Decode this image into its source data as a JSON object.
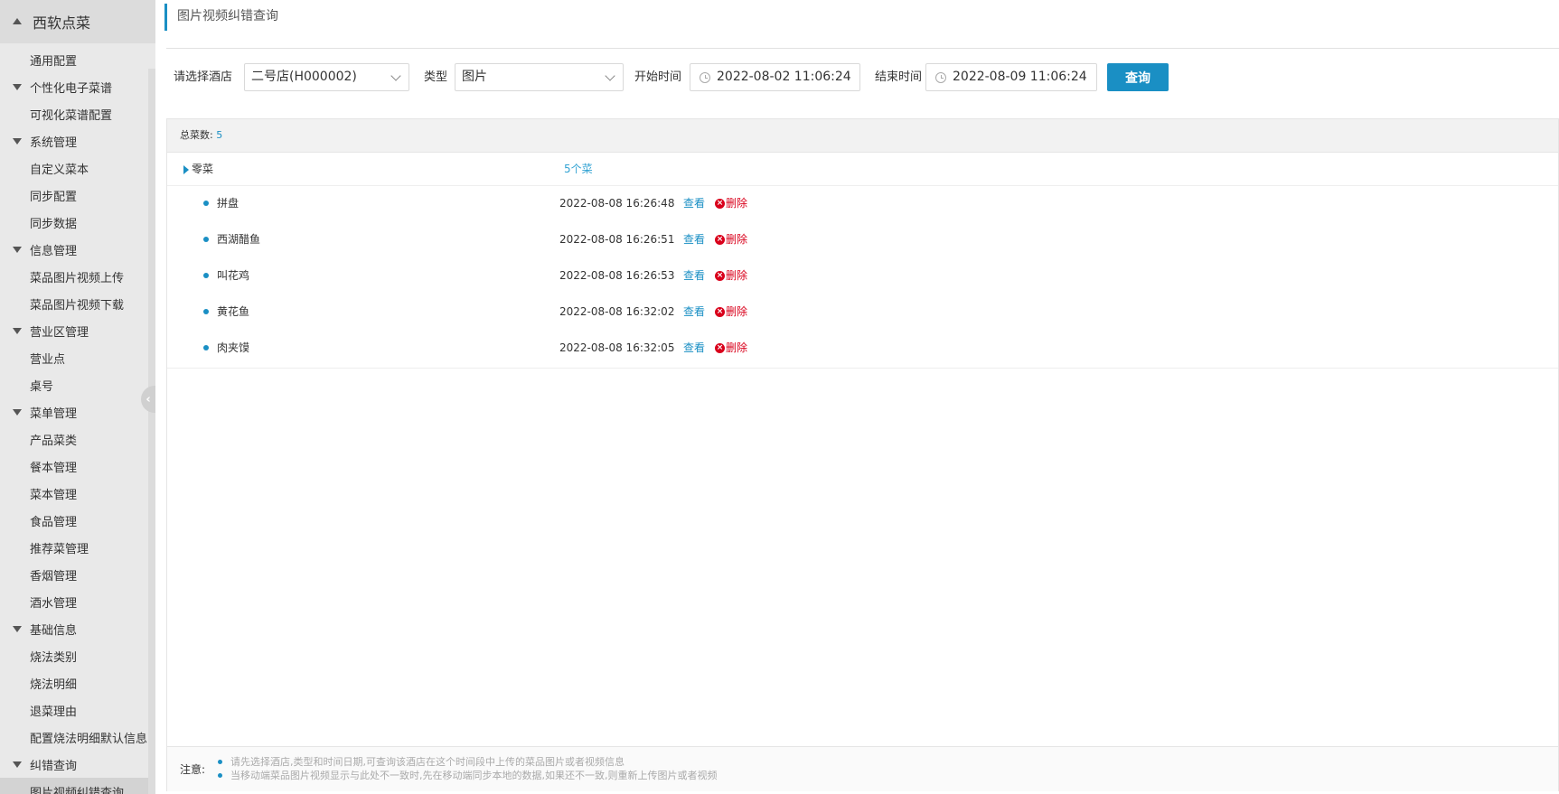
{
  "sidebar": {
    "app_title": "西软点菜",
    "items": [
      {
        "label": "通用配置",
        "type": "sub"
      },
      {
        "label": "个性化电子菜谱",
        "type": "group"
      },
      {
        "label": "可视化菜谱配置",
        "type": "sub"
      },
      {
        "label": "系统管理",
        "type": "group"
      },
      {
        "label": "自定义菜本",
        "type": "sub"
      },
      {
        "label": "同步配置",
        "type": "sub"
      },
      {
        "label": "同步数据",
        "type": "sub"
      },
      {
        "label": "信息管理",
        "type": "group"
      },
      {
        "label": "菜品图片视频上传",
        "type": "sub"
      },
      {
        "label": "菜品图片视频下载",
        "type": "sub"
      },
      {
        "label": "营业区管理",
        "type": "group"
      },
      {
        "label": "营业点",
        "type": "sub"
      },
      {
        "label": "桌号",
        "type": "sub"
      },
      {
        "label": "菜单管理",
        "type": "group"
      },
      {
        "label": "产品菜类",
        "type": "sub"
      },
      {
        "label": "餐本管理",
        "type": "sub"
      },
      {
        "label": "菜本管理",
        "type": "sub"
      },
      {
        "label": "食品管理",
        "type": "sub"
      },
      {
        "label": "推荐菜管理",
        "type": "sub"
      },
      {
        "label": "香烟管理",
        "type": "sub"
      },
      {
        "label": "酒水管理",
        "type": "sub"
      },
      {
        "label": "基础信息",
        "type": "group"
      },
      {
        "label": "烧法类别",
        "type": "sub"
      },
      {
        "label": "烧法明细",
        "type": "sub"
      },
      {
        "label": "退菜理由",
        "type": "sub"
      },
      {
        "label": "配置烧法明细默认信息",
        "type": "sub"
      },
      {
        "label": "纠错查询",
        "type": "group"
      },
      {
        "label": "图片视频纠错查询",
        "type": "sub",
        "active": true
      }
    ]
  },
  "page": {
    "title": "图片视频纠错查询"
  },
  "filters": {
    "hotel_label": "请选择酒店",
    "hotel_value": "二号店(H000002)",
    "type_label": "类型",
    "type_value": "图片",
    "start_label": "开始时间",
    "start_value": "2022-08-02 11:06:24",
    "end_label": "结束时间",
    "end_value": "2022-08-09 11:06:24",
    "query_button": "查询"
  },
  "summary": {
    "total_label": "总菜数:",
    "total_value": "5"
  },
  "category": {
    "name": "零菜",
    "count_label": "5个菜"
  },
  "dishes": [
    {
      "name": "拼盘",
      "time": "2022-08-08 16:26:48",
      "view": "查看",
      "delete": "删除"
    },
    {
      "name": "西湖醋鱼",
      "time": "2022-08-08 16:26:51",
      "view": "查看",
      "delete": "删除"
    },
    {
      "name": "叫花鸡",
      "time": "2022-08-08 16:26:53",
      "view": "查看",
      "delete": "删除"
    },
    {
      "name": "黄花鱼",
      "time": "2022-08-08 16:32:02",
      "view": "查看",
      "delete": "删除"
    },
    {
      "name": "肉夹馍",
      "time": "2022-08-08 16:32:05",
      "view": "查看",
      "delete": "删除"
    }
  ],
  "note": {
    "label": "注意:",
    "lines": [
      "请先选择酒店,类型和时间日期,可查询该酒店在这个时间段中上传的菜品图片或者视频信息",
      "当移动端菜品图片视频显示与此处不一致时,先在移动端同步本地的数据,如果还不一致,则重新上传图片或者视频"
    ]
  },
  "colors": {
    "accent": "#1a8fc4",
    "danger": "#d9001b",
    "sidebar_bg": "#e9e9e9"
  }
}
